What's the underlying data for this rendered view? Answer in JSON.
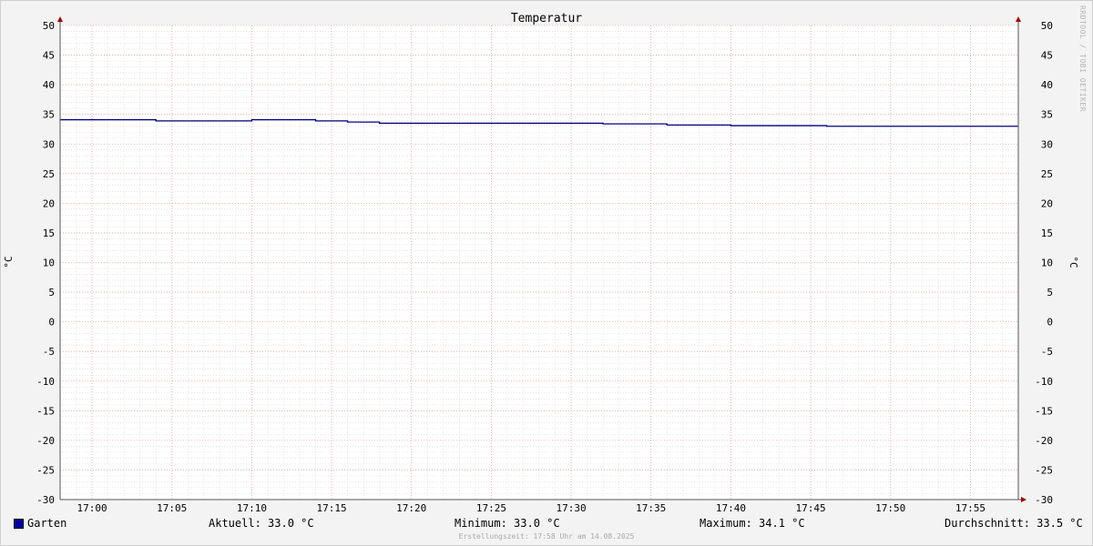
{
  "chart_data": {
    "type": "line",
    "title": "Temperatur",
    "ylabel": "°C",
    "ylabel_right": "°C",
    "ylim": [
      -30,
      50
    ],
    "xlim": [
      "16:58",
      "17:58"
    ],
    "y_ticks": [
      "50",
      "45",
      "40",
      "35",
      "30",
      "25",
      "20",
      "15",
      "10",
      "5",
      "0",
      "-5",
      "-10",
      "-15",
      "-20",
      "-25",
      "-30"
    ],
    "x_ticks": [
      "17:00",
      "17:05",
      "17:10",
      "17:15",
      "17:20",
      "17:25",
      "17:30",
      "17:35",
      "17:40",
      "17:45",
      "17:50",
      "17:55"
    ],
    "grid": true,
    "series": [
      {
        "name": "Garten",
        "color": "#000080",
        "step": true,
        "x": [
          "16:58",
          "17:04",
          "17:10",
          "17:14",
          "17:16",
          "17:18",
          "17:32",
          "17:36",
          "17:40",
          "17:46",
          "17:58"
        ],
        "values": [
          34.1,
          33.9,
          34.1,
          33.9,
          33.7,
          33.5,
          33.4,
          33.2,
          33.1,
          33.0,
          33.0
        ]
      }
    ]
  },
  "legend": {
    "series_name": "Garten",
    "series_color": "#0000a0",
    "current": "Aktuell: 33.0 °C",
    "minimum": "Minimum: 33.0 °C",
    "maximum": "Maximum: 34.1 °C",
    "average": "Durchschnitt: 33.5 °C"
  },
  "footer": "Erstellungszeit: 17:58 Uhr am 14.08.2025",
  "watermark": "RRDTOOL / TOBI OETIKER"
}
